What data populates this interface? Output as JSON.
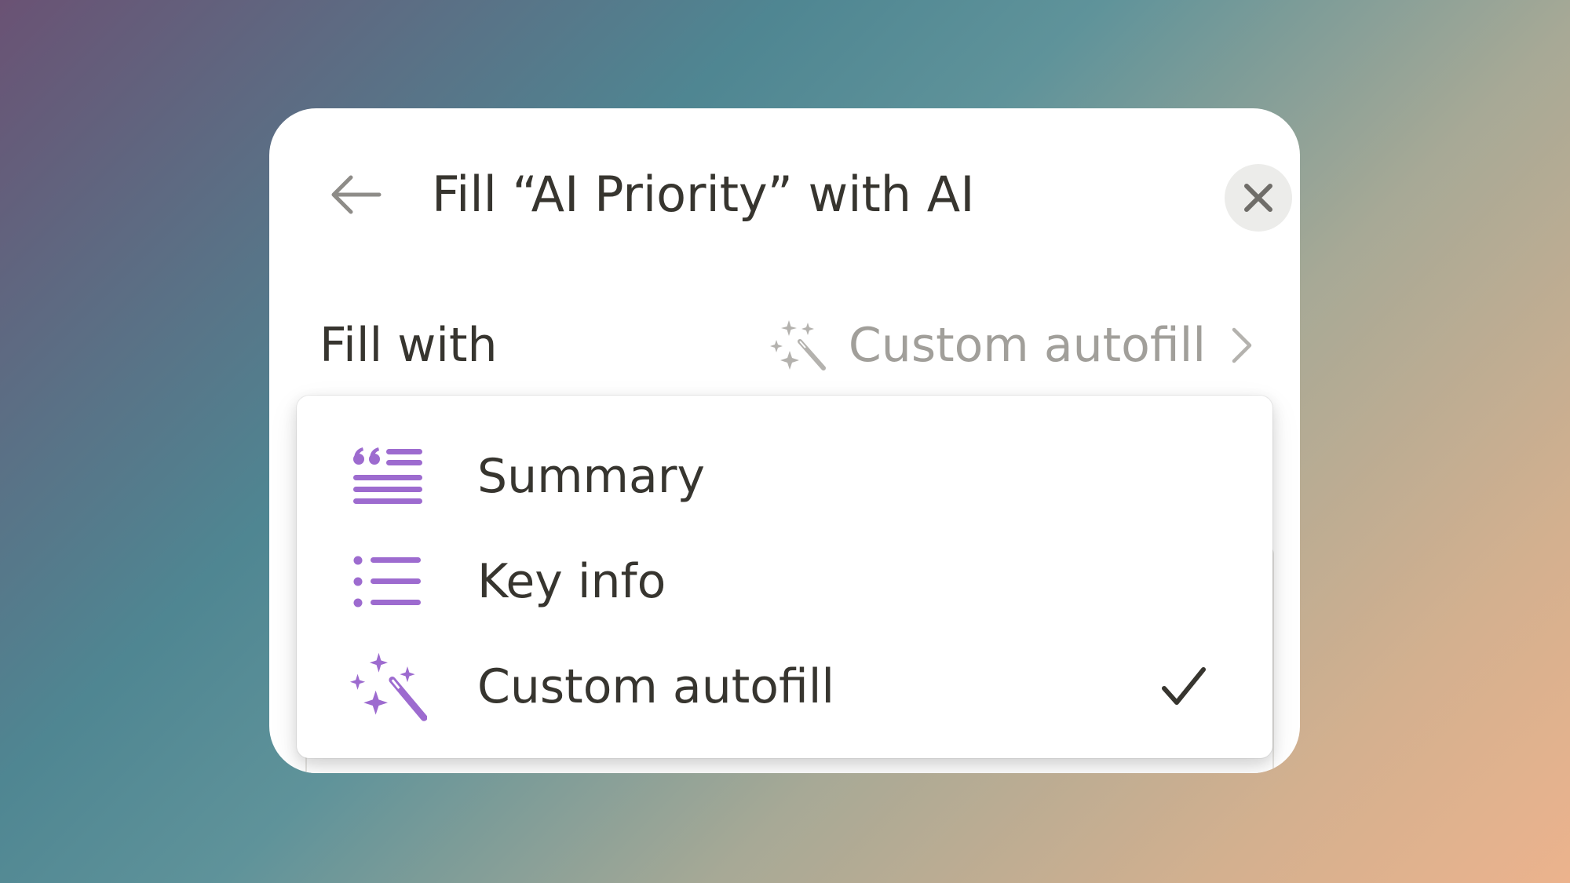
{
  "dialog": {
    "title": "Fill “AI Priority” with AI",
    "back_icon": "arrow-left-icon",
    "close_icon": "close-icon"
  },
  "fill_with": {
    "label": "Fill with",
    "value": "Custom autofill",
    "value_icon": "magic-wand-icon",
    "chevron_icon": "chevron-right-icon"
  },
  "dropdown": {
    "items": [
      {
        "label": "Summary",
        "icon": "quote-lines-icon",
        "selected": false
      },
      {
        "label": "Key info",
        "icon": "bulleted-list-icon",
        "selected": false
      },
      {
        "label": "Custom autofill",
        "icon": "magic-wand-icon",
        "selected": true
      }
    ]
  },
  "colors": {
    "accent_purple": "#9d6bcf",
    "text": "#37352f",
    "muted_text": "#a19f9a"
  }
}
